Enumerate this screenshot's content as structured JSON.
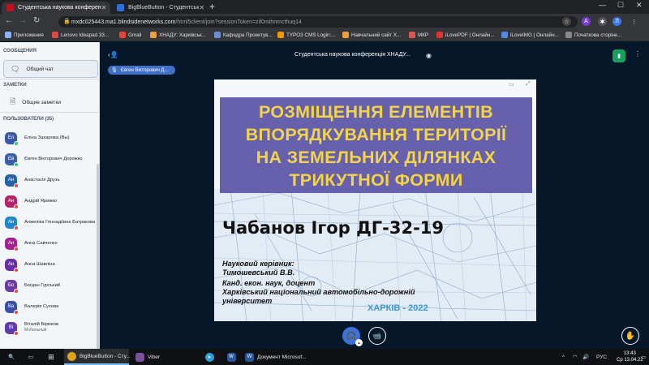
{
  "browser": {
    "tabs": [
      {
        "label": "Студентська наукова конферен",
        "active": true
      },
      {
        "label": "BigBlueButton - Студентськ",
        "active": false
      }
    ],
    "window_controls": {
      "minimize": "—",
      "maximize": "☐",
      "close": "✕"
    },
    "url": {
      "host": "mxdc025443.ma1.blindsidenetworks.com",
      "path": "/html5client/join?sessionToken=zif0mihnmcthuq14"
    },
    "profile_initial": "Л",
    "bookmarks": [
      {
        "label": "Приложения",
        "color": "#8ab4f8"
      },
      {
        "label": "Lenovo Ideapad 33...",
        "color": "#e04848"
      },
      {
        "label": "Gmail",
        "color": "#ea4335"
      },
      {
        "label": "ХНАДУ: Харківськ...",
        "color": "#e9a23b"
      },
      {
        "label": "Кафедра Проектув...",
        "color": "#6b8fd6"
      },
      {
        "label": "TYPO3 CMS Login:...",
        "color": "#f49700"
      },
      {
        "label": "Навчальний сайт Х...",
        "color": "#e9a23b"
      },
      {
        "label": "МКР",
        "color": "#d55"
      },
      {
        "label": "iLovePDF | Онлайн...",
        "color": "#e5322d"
      },
      {
        "label": "iLoveIMG | Онлайн...",
        "color": "#4d8be0"
      },
      {
        "label": "Початкова сторінк...",
        "color": "#888"
      }
    ]
  },
  "sidebar": {
    "messages_title": "СООБЩЕНИЯ",
    "public_chat": "Общий чат",
    "notes_title": "ЗАМЕТКИ",
    "shared_notes": "Общие заметки",
    "users_title": "ПОЛЬЗОВАТЕЛИ (35)",
    "users": [
      {
        "initials": "Ел",
        "name": "Еліна Захарова (Вы)",
        "sub": "",
        "color": "#3d55a8",
        "status": "#2ecc71"
      },
      {
        "initials": "Єв",
        "name": "Євген Вікторович Дорожко",
        "sub": "",
        "color": "#3f5fa8",
        "status": "#2ecc71"
      },
      {
        "initials": "Ан",
        "name": "Анастасія Друзь",
        "sub": "",
        "color": "#2364a8",
        "status": "#e74c3c"
      },
      {
        "initials": "Ан",
        "name": "Андрій Ярижко",
        "sub": "",
        "color": "#b5246b",
        "status": "#e74c3c"
      },
      {
        "initials": "Ан",
        "name": "Анжеліка Геннадіївна Батракова",
        "sub": "",
        "color": "#1e88c8",
        "status": "#e74c3c"
      },
      {
        "initials": "Ан",
        "name": "Анна Савченко",
        "sub": "",
        "color": "#a3218e",
        "status": "#e74c3c"
      },
      {
        "initials": "Ан",
        "name": "Анна Шавліна",
        "sub": "",
        "color": "#6a2fa8",
        "status": "#e74c3c"
      },
      {
        "initials": "Бо",
        "name": "Богдан Гурський",
        "sub": "",
        "color": "#6d3ba3",
        "status": "#e74c3c"
      },
      {
        "initials": "Ва",
        "name": "Валерія Сухова",
        "sub": "",
        "color": "#3a4fa8",
        "status": "#e74c3c"
      },
      {
        "initials": "Ві",
        "name": "Віталій Бірюков",
        "sub": "Мобильный",
        "color": "#5b3ca8",
        "status": "#e74c3c"
      }
    ]
  },
  "main": {
    "meeting_title": "Студентська наукова конференція ХНАДУ...",
    "presenter": "Євген Вікторович Д..."
  },
  "slide": {
    "title_lines": [
      "РОЗМІЩЕННЯ ЕЛЕМЕНТІВ",
      "ВПОРЯДКУВАННЯ ТЕРИТОРІЇ",
      "НА ЗЕМЕЛЬНИХ ДІЛЯНКАХ",
      "ТРИКУТНОЇ ФОРМИ"
    ],
    "author": "Чабанов Ігор ДГ-32-19",
    "supervisor_lines": [
      "Науковий керівник:",
      "Тимошевський В.В.",
      "Канд. екон. наук, доцент",
      "Харківський національний автомобільно-дорожній",
      "університет"
    ],
    "city": "ХАРКІВ - 2022"
  },
  "taskbar": {
    "items": [
      {
        "label": "BigBlueButton - Сту...",
        "color": "#e0a21b",
        "active": true
      },
      {
        "label": "Viber",
        "color": "#7b519d",
        "active": false
      },
      {
        "label": "",
        "color": "#2aa0da",
        "active": false
      },
      {
        "label": "Документ Microsof...",
        "color": "#2b579a",
        "active": false
      }
    ],
    "language": "РУС",
    "time": "13:43",
    "date": "Ср 13.04.22"
  },
  "colors": {
    "main_bg": "#06172a",
    "accent": "#3a72d8",
    "banner": "#6660ad",
    "banner_text": "#f2d44a"
  }
}
